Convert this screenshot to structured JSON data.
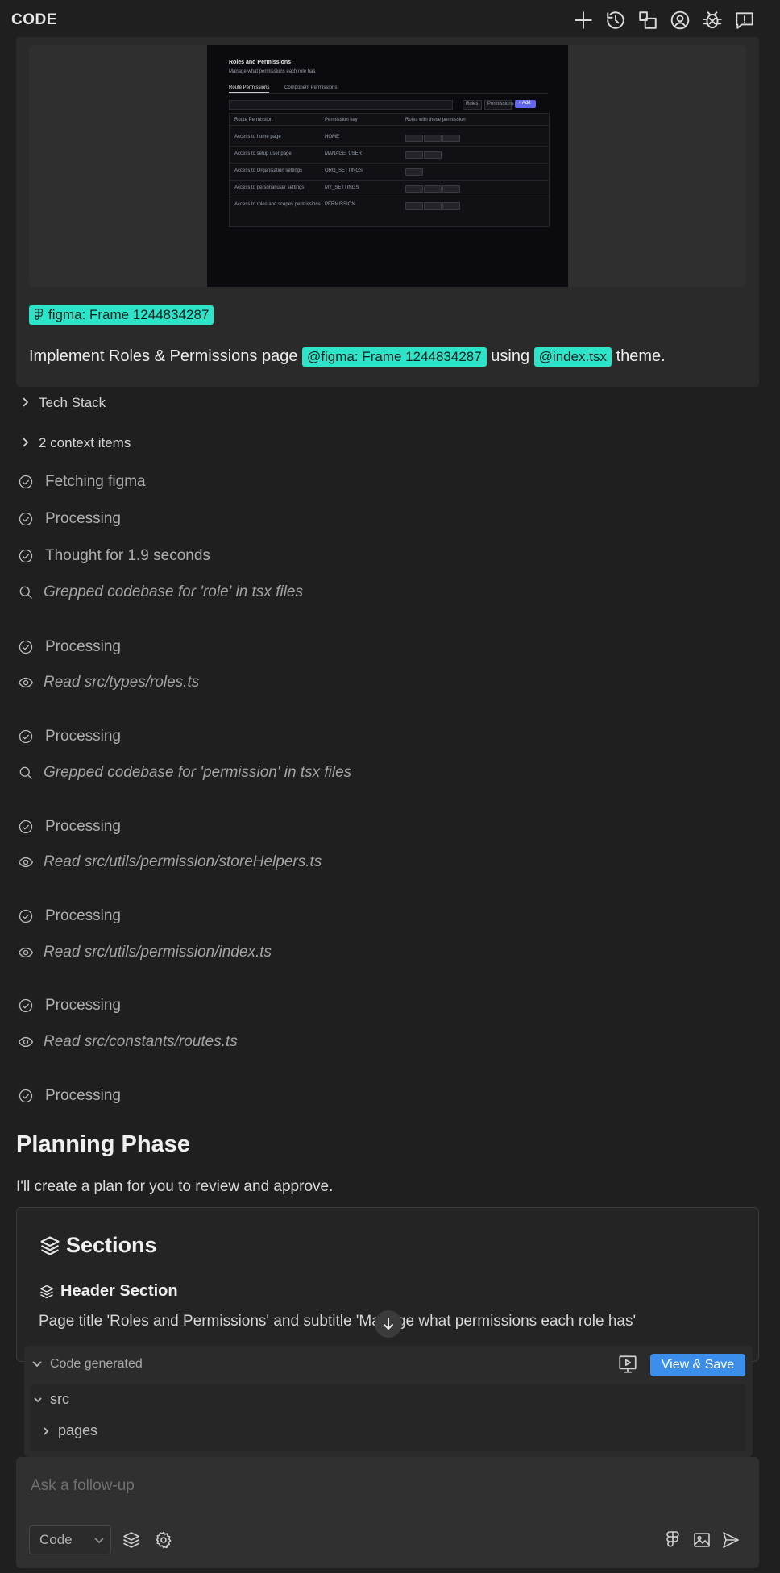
{
  "header": {
    "title": "CODE",
    "icons": [
      "plus-icon",
      "history-icon",
      "layout-icon",
      "account-icon",
      "bug-icon",
      "feedback-icon"
    ]
  },
  "attachment_preview": {
    "title": "Roles and Permissions",
    "subtitle": "Manage what permissions each role has",
    "tabs": [
      "Route Permissions",
      "Component Permissions"
    ],
    "filters": [
      "Roles",
      "Permissions"
    ],
    "add_button": "+ Add",
    "columns": [
      "Route Permission",
      "Permission key",
      "Roles with these permission"
    ],
    "rows": [
      {
        "name": "Access to home page",
        "key": "HOME",
        "chips": 3
      },
      {
        "name": "Access to setup user page",
        "key": "MANAGE_USER",
        "chips": 2
      },
      {
        "name": "Access to Organisation settings",
        "key": "ORG_SETTINGS",
        "chips": 1
      },
      {
        "name": "Access to personal user settings",
        "key": "MY_SETTINGS",
        "chips": 3
      },
      {
        "name": "Access to roles and scopes permissions",
        "key": "PERMISSION",
        "chips": 3
      }
    ]
  },
  "message": {
    "figma_chip": "figma: Frame 1244834287",
    "prompt_prefix": "Implement Roles & Permissions page",
    "mention_figma": "@figma: Frame 1244834287",
    "prompt_mid": "using",
    "mention_file": "@index.tsx",
    "prompt_suffix": "theme."
  },
  "collapsibles": {
    "tech_stack": "Tech Stack",
    "context": "2 context items"
  },
  "steps": [
    {
      "type": "check",
      "text": "Fetching figma"
    },
    {
      "type": "check",
      "text": "Processing"
    },
    {
      "type": "check",
      "text": "Thought for 1.9 seconds"
    },
    {
      "type": "search",
      "text": "Grepped codebase for 'role' in tsx files"
    },
    {
      "type": "check",
      "text": "Processing"
    },
    {
      "type": "read",
      "text": "Read src/types/roles.ts"
    },
    {
      "type": "check",
      "text": "Processing"
    },
    {
      "type": "search",
      "text": "Grepped codebase for 'permission' in tsx files"
    },
    {
      "type": "check",
      "text": "Processing"
    },
    {
      "type": "read",
      "text": "Read src/utils/permission/storeHelpers.ts"
    },
    {
      "type": "check",
      "text": "Processing"
    },
    {
      "type": "read",
      "text": "Read src/utils/permission/index.ts"
    },
    {
      "type": "check",
      "text": "Processing"
    },
    {
      "type": "read",
      "text": "Read src/constants/routes.ts"
    },
    {
      "type": "check",
      "text": "Processing"
    }
  ],
  "planning": {
    "title": "Planning Phase",
    "description": "I'll create a plan for you to review and approve.",
    "sections_title": "Sections",
    "section_name": "Header Section",
    "section_desc": "Page title 'Roles and Permissions' and subtitle 'Manage what permissions each role has'"
  },
  "code_generated": {
    "label": "Code generated",
    "view_save": "View & Save",
    "tree": [
      "src",
      "pages"
    ]
  },
  "composer": {
    "placeholder": "Ask a follow-up",
    "mode": "Code"
  },
  "colors": {
    "background": "#1f1f1f",
    "chip": "#2de3c8",
    "primary_button": "#3b8eea"
  }
}
